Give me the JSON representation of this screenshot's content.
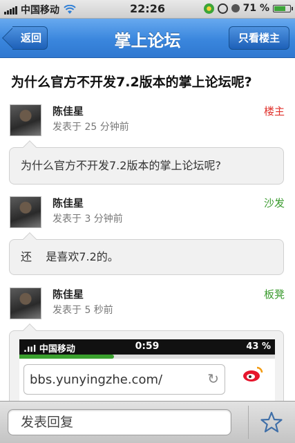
{
  "status_bar": {
    "carrier": "中国移动",
    "time": "22:26",
    "battery": "71 %",
    "battery_level": 0.71
  },
  "nav": {
    "back_label": "返回",
    "title": "掌上论坛",
    "owner_only_label": "只看楼主"
  },
  "topic": {
    "title": "为什么官方不开发7.2版本的掌上论坛呢?"
  },
  "posts": [
    {
      "author": "陈佳星",
      "time": "发表于 25 分钟前",
      "floor": "楼主",
      "floor_color": "#e0302a",
      "content": "为什么官方不开发7.2版本的掌上论坛呢?"
    },
    {
      "author": "陈佳星",
      "time": "发表于 3 分钟前",
      "floor": "沙发",
      "floor_color": "#3a9b2e",
      "content": "还    是喜欢7.2的。"
    },
    {
      "author": "陈佳星",
      "time": "发表于 5 秒前",
      "floor": "板凳",
      "floor_color": "#3a9b2e",
      "attachment": {
        "carrier": "中国移动",
        "time": "0:59",
        "battery": "43 %",
        "url": "bbs.yunyingzhe.com/",
        "load_progress": 0.37
      }
    }
  ],
  "bottom": {
    "reply_placeholder": "发表回复"
  }
}
